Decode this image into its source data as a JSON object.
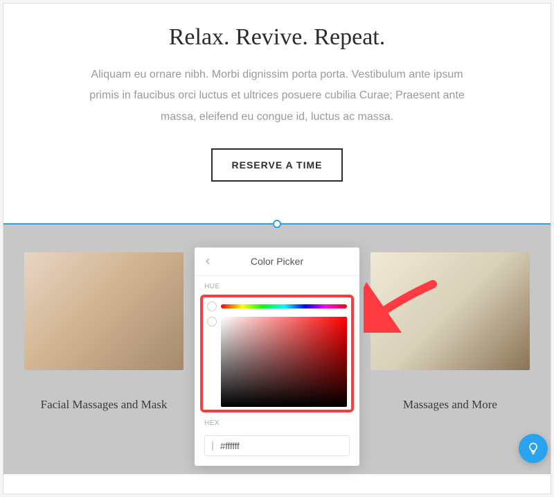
{
  "hero": {
    "title": "Relax. Revive. Repeat.",
    "body": "Aliquam eu ornare nibh. Morbi dignissim porta porta. Vestibulum ante ipsum primis in faucibus orci luctus et ultrices posuere cubilia Curae; Praesent ante massa, eleifend eu congue id, luctus ac massa.",
    "cta_label": "RESERVE A TIME"
  },
  "gallery": {
    "left_caption": "Facial Massages and Mask",
    "right_caption": "Massages and More"
  },
  "color_picker": {
    "title": "Color Picker",
    "hue_label": "HUE",
    "hex_label": "HEX",
    "hex_value": "#ffffff"
  }
}
